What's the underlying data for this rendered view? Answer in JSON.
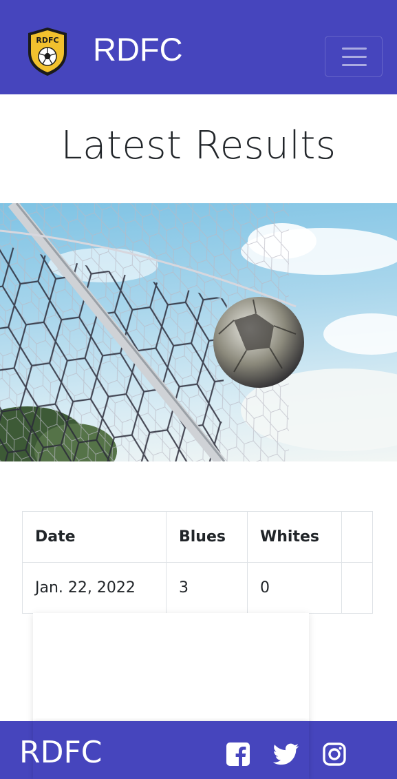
{
  "navbar": {
    "brand_name": "RDFC",
    "logo_text": "RDFC",
    "menu_icon": "hamburger-menu-icon",
    "background": "#4645bd"
  },
  "main": {
    "title": "Latest Results"
  },
  "hero_image": {
    "subject": "soccer ball hitting goal net"
  },
  "results": {
    "headers": [
      "Date",
      "Blues",
      "Whites",
      ""
    ],
    "rows": [
      [
        "Jan. 22, 2022",
        "3",
        "0",
        ""
      ]
    ]
  },
  "footer": {
    "brand_name": "RDFC",
    "social_icons": [
      "facebook-icon",
      "twitter-icon",
      "instagram-icon"
    ]
  }
}
